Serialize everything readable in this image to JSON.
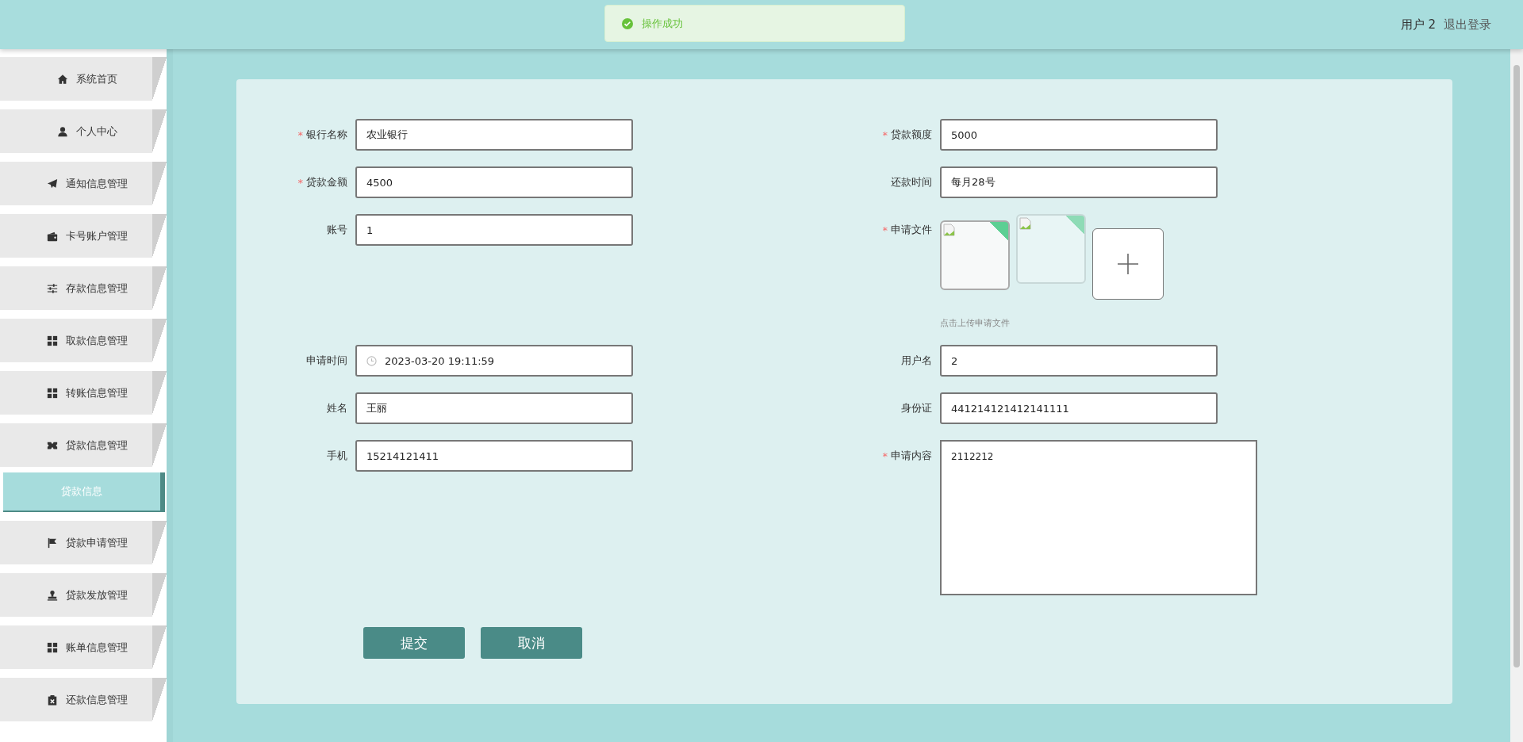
{
  "toast": {
    "message": "操作成功"
  },
  "header": {
    "user": "用户 2",
    "logout": "退出登录"
  },
  "sidebar": {
    "items": [
      {
        "label": "系统首页"
      },
      {
        "label": "个人中心"
      },
      {
        "label": "通知信息管理"
      },
      {
        "label": "卡号账户管理"
      },
      {
        "label": "存款信息管理"
      },
      {
        "label": "取款信息管理"
      },
      {
        "label": "转账信息管理"
      },
      {
        "label": "贷款信息管理",
        "children": [
          {
            "label": "贷款信息",
            "selected": true
          }
        ]
      },
      {
        "label": "贷款申请管理"
      },
      {
        "label": "贷款发放管理"
      },
      {
        "label": "账单信息管理"
      },
      {
        "label": "还款信息管理"
      }
    ]
  },
  "form": {
    "rows": [
      [
        {
          "label": "银行名称",
          "required_mark": "*",
          "kind": "text",
          "value": "农业银行"
        },
        {
          "label": "贷款额度",
          "required_mark": "*",
          "kind": "text",
          "value": "5000"
        }
      ],
      [
        {
          "label": "贷款金额",
          "required_mark": "*",
          "kind": "text",
          "value": "4500"
        },
        {
          "label": "还款时间",
          "kind": "text",
          "value": "每月28号"
        }
      ],
      [
        {
          "label": "账号",
          "kind": "text",
          "value": "1"
        },
        {
          "label": "申请文件",
          "required_mark": "*",
          "kind": "upload",
          "previews": [
            {
              "kind": "broken-image"
            },
            {
              "kind": "broken-image"
            }
          ],
          "hint": "点击上传申请文件"
        }
      ],
      [
        {
          "label": "申请时间",
          "kind": "date",
          "value": "2023-03-20 19:11:59"
        },
        {
          "label": "用户名",
          "kind": "text",
          "value": "2"
        }
      ],
      [
        {
          "label": "姓名",
          "kind": "text",
          "value": "王丽"
        },
        {
          "label": "身份证",
          "kind": "text",
          "value": "441214121412141111"
        }
      ],
      [
        {
          "label": "手机",
          "kind": "text",
          "value": "15214121411"
        },
        {
          "label": "申请内容",
          "required_mark": "*",
          "kind": "textarea",
          "value": "2112212"
        }
      ]
    ],
    "buttons": [
      {
        "label": "提交"
      },
      {
        "label": "取消"
      }
    ]
  }
}
